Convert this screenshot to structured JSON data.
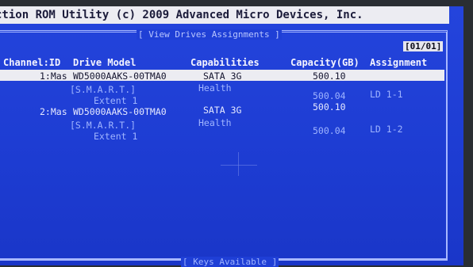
{
  "title": "ction ROM Utility (c) 2009 Advanced Micro Devices, Inc.",
  "frame_title": "[ View Drives Assignments ]",
  "page_indicator": "[01/01]",
  "columns": {
    "channel_id": "Channel:ID",
    "drive_model": "Drive Model",
    "capabilities": "Capabilities",
    "capacity": "Capacity(GB)",
    "assignment": "Assignment"
  },
  "drives": [
    {
      "channel": "1:Mas",
      "model": "WD5000AAKS-00TMA0",
      "capabilities": "SATA 3G",
      "capacity": "500.10",
      "smart_label": "[S.M.A.R.T.]",
      "smart_status": "Health",
      "extent_label": "Extent 1",
      "extent_capacity": "500.04",
      "assignment": "LD  1-1"
    },
    {
      "channel": "2:Mas",
      "model": "WD5000AAKS-00TMA0",
      "capabilities": "SATA 3G",
      "capacity": "500.10",
      "smart_label": "[S.M.A.R.T.]",
      "smart_status": "Health",
      "extent_label": "Extent 1",
      "extent_capacity": "500.04",
      "assignment": "LD  1-2"
    }
  ],
  "keys_title": "[ Keys Available ]",
  "colors": {
    "background": "#1f3fd6",
    "highlight": "#ececf2",
    "text": "#e6e9ff",
    "dim_text": "#9fb4ff"
  }
}
